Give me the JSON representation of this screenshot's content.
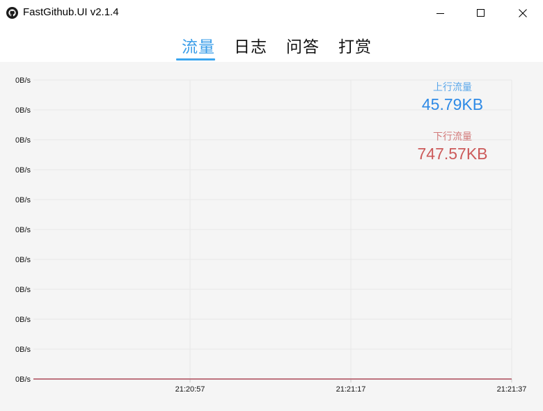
{
  "window": {
    "title": "FastGithub.UI v2.1.4",
    "icon": "github-icon",
    "controls": [
      "minimize-icon",
      "maximize-icon",
      "close-icon"
    ]
  },
  "tabs": [
    {
      "label": "流量",
      "active": true
    },
    {
      "label": "日志",
      "active": false
    },
    {
      "label": "问答",
      "active": false
    },
    {
      "label": "打赏",
      "active": false
    }
  ],
  "stats": {
    "upload_label": "上行流量",
    "upload_value": "45.79KB",
    "download_label": "下行流量",
    "download_value": "747.57KB"
  },
  "colors": {
    "accent": "#3a9de8",
    "upload": "#2e8ae6",
    "download": "#cc5a5a",
    "chart_bg": "#f5f5f5"
  },
  "chart_data": {
    "type": "line",
    "title": "",
    "xlabel": "",
    "ylabel": "",
    "y_tick_labels": [
      "0B/s",
      "0B/s",
      "0B/s",
      "0B/s",
      "0B/s",
      "0B/s",
      "0B/s",
      "0B/s",
      "0B/s",
      "0B/s",
      "0B/s"
    ],
    "x_tick_labels": [
      "21:20:57",
      "21:21:17",
      "21:21:37"
    ],
    "grid": true,
    "legend": "top-right",
    "series": [
      {
        "name": "上行流量",
        "color": "#2e8ae6",
        "values": [
          0,
          0,
          0
        ]
      },
      {
        "name": "下行流量",
        "color": "#cc5a5a",
        "values": [
          0,
          0,
          0
        ]
      }
    ]
  }
}
